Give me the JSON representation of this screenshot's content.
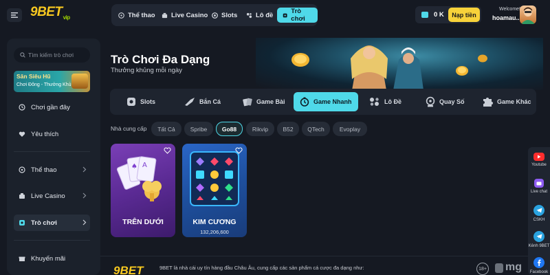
{
  "header": {
    "logo": "9BET",
    "logo_suffix": "vip",
    "nav": [
      "Thể thao",
      "Live Casino",
      "Slots",
      "Lô đề",
      "Trò chơi"
    ],
    "active_nav": "Trò chơi",
    "balance": "0 K",
    "deposit_label": "Nạp tiền",
    "welcome": "Welcome!",
    "username": "hoamau.."
  },
  "sidebar": {
    "search_placeholder": "Tìm kiếm trò chơi",
    "promo_title": "Săn Siêu Hũ",
    "promo_subtitle": "Chơi Đông - Thưởng Khủng",
    "items": [
      {
        "label": "Chơi gần đây",
        "icon": "clock-icon"
      },
      {
        "label": "Yêu thích",
        "icon": "heart-icon"
      },
      {
        "label": "Thể thao",
        "icon": "soccer-icon"
      },
      {
        "label": "Live Casino",
        "icon": "casino-icon"
      },
      {
        "label": "Trò chơi",
        "icon": "game-icon"
      },
      {
        "label": "Khuyến mãi",
        "icon": "gift-icon"
      }
    ],
    "active_item": "Trò chơi"
  },
  "banner": {
    "title": "Trò Chơi Đa Dạng",
    "subtitle": "Thưởng khủng mỗi ngày"
  },
  "category_tabs": [
    "Slots",
    "Bắn Cá",
    "Game Bài",
    "Game Nhanh",
    "Lô Đề",
    "Quay Số",
    "Game Khác"
  ],
  "active_category": "Game Nhanh",
  "providers": {
    "label": "Nhà cung cấp",
    "items": [
      "Tất Cả",
      "Spribe",
      "Go88",
      "Rikvip",
      "B52",
      "QTech",
      "Evoplay"
    ],
    "active": "Go88"
  },
  "games": [
    {
      "name": "TRÊN DƯỚI",
      "count": ""
    },
    {
      "name": "KIM CƯƠNG",
      "count": "132,206,600"
    }
  ],
  "footer": {
    "logo": "9BET",
    "text": "9BET là nhà cái uy tín hàng đầu Châu Âu, cung cấp các sản phẩm cá cược đa dạng như:",
    "age": "18+",
    "brand_mark": "mg"
  },
  "social": [
    {
      "label": "Youtube",
      "icon": "youtube-icon",
      "color": "#ff2d2d"
    },
    {
      "label": "Live chat",
      "icon": "chat-icon",
      "color": "#8e5cf2"
    },
    {
      "label": "CSKH",
      "icon": "telegram-icon",
      "color": "#2aa3e0"
    },
    {
      "label": "Kênh 9BET",
      "icon": "telegram-icon",
      "color": "#2aa3e0"
    },
    {
      "label": "Facebook",
      "icon": "facebook-icon",
      "color": "#1f77f2"
    }
  ],
  "colors": {
    "accent": "#4fd9e9",
    "deposit": "#f7d23a",
    "background": "#151922"
  }
}
